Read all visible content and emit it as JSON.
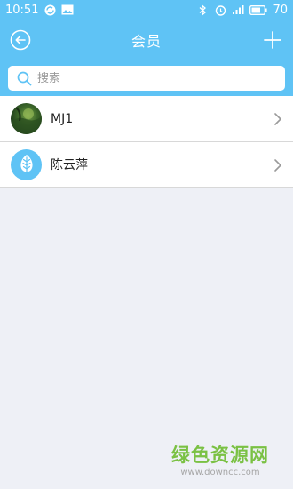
{
  "status_bar": {
    "time": "10:51",
    "battery": "70"
  },
  "header": {
    "title": "会员"
  },
  "search": {
    "placeholder": "搜索"
  },
  "members": [
    {
      "name": "MJ1",
      "avatar": "photo"
    },
    {
      "name": "陈云萍",
      "avatar": "leaf-icon"
    }
  ],
  "watermark": {
    "text": "绿色资源网",
    "url": "www.downcc.com"
  },
  "colors": {
    "accent": "#5fc3f5",
    "background": "#eef0f6",
    "watermark_green": "#7ac143"
  }
}
